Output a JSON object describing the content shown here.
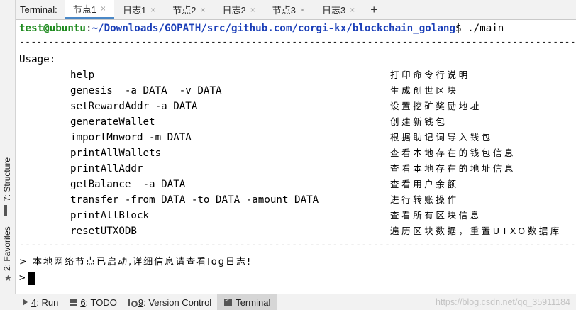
{
  "tab_bar": {
    "title": "Terminal:",
    "tabs": [
      {
        "label": "节点1",
        "active": true
      },
      {
        "label": "日志1"
      },
      {
        "label": "节点2"
      },
      {
        "label": "日志2"
      },
      {
        "label": "节点3"
      },
      {
        "label": "日志3"
      }
    ],
    "close_glyph": "×",
    "add_glyph": "+"
  },
  "side_tools": {
    "structure": {
      "num": "7",
      "label": ": Structure"
    },
    "favorites": {
      "num": "2",
      "label": ": Favorites"
    }
  },
  "terminal": {
    "prompt_user": "test@ubuntu",
    "prompt_colon": ":",
    "prompt_path": "~/Downloads/GOPATH/src/github.com/corgi-kx/blockchain_golang",
    "prompt_cmd": "$ ./main",
    "separator": "-------------------------------------------------------------------------------------------------",
    "usage_label": "Usage:",
    "commands": [
      {
        "cmd": "help",
        "desc": "打印命令行说明"
      },
      {
        "cmd": "genesis  -a DATA  -v DATA",
        "desc": "生成创世区块"
      },
      {
        "cmd": "setRewardAddr -a DATA",
        "desc": "设置挖矿奖励地址"
      },
      {
        "cmd": "generateWallet",
        "desc": "创建新钱包"
      },
      {
        "cmd": "importMnword -m DATA",
        "desc": "根据助记词导入钱包"
      },
      {
        "cmd": "printAllWallets",
        "desc": "查看本地存在的钱包信息"
      },
      {
        "cmd": "printAllAddr",
        "desc": "查看本地存在的地址信息"
      },
      {
        "cmd": "getBalance  -a DATA",
        "desc": "查看用户余额"
      },
      {
        "cmd": "transfer -from DATA -to DATA -amount DATA",
        "desc": "进行转账操作"
      },
      {
        "cmd": "printAllBlock",
        "desc": "查看所有区块信息"
      },
      {
        "cmd": "resetUTXODB",
        "desc": "遍历区块数据，重置UTXO数据库"
      }
    ],
    "status_line": "> 本地网络节点已启动,详细信息请查看log日志!",
    "input_prompt": ">"
  },
  "bottom_bar": {
    "tools": [
      {
        "num": "4",
        "label": ": Run"
      },
      {
        "num": "6",
        "label": ": TODO"
      },
      {
        "num": "9",
        "label": ": Version Control"
      },
      {
        "num": "",
        "label": "Terminal",
        "active": true
      }
    ],
    "watermark": "https://blog.csdn.net/qq_35911184"
  }
}
